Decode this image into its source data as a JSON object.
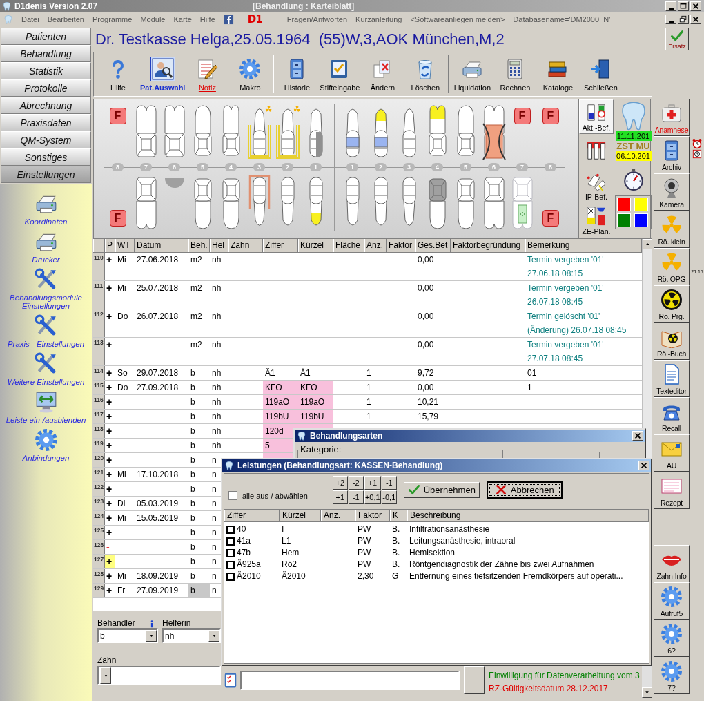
{
  "window": {
    "title": "D1denis Version 2.07",
    "document_title": "[Behandlung : Karteiblatt]"
  },
  "menu": {
    "items": [
      "Datei",
      "Bearbeiten",
      "Programme",
      "Module",
      "Karte",
      "Hilfe"
    ],
    "logo": "D1",
    "links": [
      "Fragen/Antworten",
      "Kurzanleitung",
      "<Softwareanliegen melden>",
      "Databasename='DM2000_N'"
    ]
  },
  "nav": [
    {
      "label": "Patienten",
      "selected": false
    },
    {
      "label": "Behandlung",
      "selected": false
    },
    {
      "label": "Statistik",
      "selected": false
    },
    {
      "label": "Protokolle",
      "selected": false
    },
    {
      "label": "Abrechnung",
      "selected": false
    },
    {
      "label": "Praxisdaten",
      "selected": false
    },
    {
      "label": "QM-System",
      "selected": false
    },
    {
      "label": "Sonstiges",
      "selected": false
    },
    {
      "label": "Einstellungen",
      "selected": true
    }
  ],
  "settings_panel": [
    "Koordinaten",
    "Drucker",
    "Behandlungsmodule Einstellungen",
    "Praxis - Einstellungen",
    "Weitere Einstellungen",
    "Leiste ein-/ausblenden",
    "Anbindungen"
  ],
  "patient": {
    "title": "Dr. Testkasse Helga,25.05.1964  (55)W,3,AOK München,M,2",
    "ersatz": "Ersatz"
  },
  "toolbar": {
    "groups": [
      [
        {
          "label": "Hilfe",
          "selected": false,
          "alert": false
        },
        {
          "label": "Pat.Auswahl",
          "selected": true,
          "alert": false
        },
        {
          "label": "Notiz",
          "selected": false,
          "alert": true
        },
        {
          "label": "Makro",
          "selected": false,
          "alert": false
        }
      ],
      [
        {
          "label": "Historie",
          "selected": false,
          "alert": false
        },
        {
          "label": "Stifteingabe",
          "selected": false,
          "alert": false
        },
        {
          "label": "Ändern",
          "selected": false,
          "alert": false
        },
        {
          "label": "Löschen",
          "selected": false,
          "alert": false
        }
      ],
      [
        {
          "label": "Liquidation",
          "selected": false,
          "alert": false
        },
        {
          "label": "Rechnen",
          "selected": false,
          "alert": false
        },
        {
          "label": "Kataloge",
          "selected": false,
          "alert": false
        },
        {
          "label": "Schließen",
          "selected": false,
          "alert": false
        }
      ]
    ]
  },
  "dental_chart": {
    "upper": [
      {
        "kind": "flag",
        "label": "F"
      },
      {
        "kind": "molar"
      },
      {
        "kind": "molar"
      },
      {
        "kind": "premolar"
      },
      {
        "kind": "premolar-double"
      },
      {
        "kind": "canine",
        "findings": [
          {
            "kind": "bridge"
          },
          {
            "kind": "xray"
          }
        ]
      },
      {
        "kind": "incisor",
        "findings": [
          {
            "kind": "bridge"
          },
          {
            "kind": "xray"
          }
        ]
      },
      {
        "kind": "incisor",
        "findings": [
          {
            "kind": "amalgam"
          }
        ]
      },
      {
        "kind": "incisor",
        "findings": [
          {
            "kind": "composite"
          }
        ]
      },
      {
        "kind": "incisor",
        "findings": [
          {
            "kind": "tip-yellow"
          },
          {
            "kind": "composite"
          }
        ]
      },
      {
        "kind": "canine"
      },
      {
        "kind": "premolar-double",
        "findings": [
          {
            "kind": "tip-yellow"
          }
        ]
      },
      {
        "kind": "premolar"
      },
      {
        "kind": "molar",
        "findings": [
          {
            "kind": "extracted"
          }
        ]
      },
      {
        "kind": "flag",
        "label": "F"
      },
      {
        "kind": "flag",
        "label": "F"
      }
    ],
    "numbers": [
      "8",
      "7",
      "6",
      "5",
      "4",
      "3",
      "2",
      "1",
      "1",
      "2",
      "3",
      "4",
      "5",
      "6",
      "7",
      "8"
    ],
    "lower": [
      {
        "kind": "flag",
        "label": "F"
      },
      {
        "kind": "molar"
      },
      {
        "kind": "molar",
        "findings": [
          {
            "kind": "pontic"
          }
        ]
      },
      {
        "kind": "premolar"
      },
      {
        "kind": "premolar"
      },
      {
        "kind": "canine",
        "findings": [
          {
            "kind": "crown-frame"
          }
        ]
      },
      {
        "kind": "incisor"
      },
      {
        "kind": "incisor",
        "findings": [
          {
            "kind": "tip-yellow"
          }
        ]
      },
      {
        "kind": "incisor"
      },
      {
        "kind": "incisor"
      },
      {
        "kind": "canine"
      },
      {
        "kind": "premolar",
        "findings": [
          {
            "kind": "crown-grey"
          }
        ]
      },
      {
        "kind": "premolar"
      },
      {
        "kind": "molar"
      },
      {
        "kind": "molar",
        "findings": [
          {
            "kind": "implant"
          }
        ]
      },
      {
        "kind": "flag",
        "label": "F"
      }
    ]
  },
  "chart_side": {
    "buttons": [
      {
        "label": "Akt.-Bef.",
        "selected": true
      },
      {
        "selected": false
      },
      {
        "label": "IP-Bef.",
        "selected": false
      },
      {
        "label": "ZE-Plan.",
        "selected": false
      }
    ],
    "recall_date": "11.11.201",
    "status": "ZST MU",
    "next_date": "06.10.201",
    "swatches": [
      {
        "color": "#ff0000"
      },
      {
        "color": "#ffff00"
      },
      {
        "color": "#008000"
      },
      {
        "color": "#0000ff"
      }
    ]
  },
  "table": {
    "columns": [
      "P",
      "WT",
      "Datum",
      "Beh.",
      "Hel",
      "Zahn",
      "Ziffer",
      "Kürzel",
      "Fläche",
      "Anz.",
      "Faktor",
      "Ges.Bet",
      "Faktorbegründung",
      "Bemerkung"
    ],
    "rows": [
      {
        "number": "110",
        "sign": "+",
        "weekday": "Mi",
        "date": "27.06.2018",
        "behandler": "m2",
        "helferin": "nh",
        "betrag": "0,00",
        "bemerkung": "Termin vergeben '01'\n27.06.18 08:15",
        "appointment": true,
        "highlighted": false,
        "marked": false,
        "removed": false,
        "selected": false
      },
      {
        "number": "111",
        "sign": "+",
        "weekday": "Mi",
        "date": "25.07.2018",
        "behandler": "m2",
        "helferin": "nh",
        "betrag": "0,00",
        "bemerkung": "Termin vergeben '01'\n26.07.18 08:45",
        "appointment": true,
        "highlighted": false,
        "marked": false,
        "removed": false,
        "selected": false
      },
      {
        "number": "112",
        "sign": "+",
        "weekday": "Do",
        "date": "26.07.2018",
        "behandler": "m2",
        "helferin": "nh",
        "betrag": "0,00",
        "bemerkung": "Termin gelöscht '01'\n(Änderung) 26.07.18 08:45",
        "appointment": true,
        "highlighted": false,
        "marked": false,
        "removed": false,
        "selected": false
      },
      {
        "number": "113",
        "sign": "+",
        "behandler": "m2",
        "helferin": "nh",
        "betrag": "0,00",
        "bemerkung": "Termin vergeben '01'\n27.07.18 08:45",
        "appointment": true,
        "highlighted": false,
        "marked": false,
        "removed": false,
        "selected": false
      },
      {
        "number": "114",
        "sign": "+",
        "weekday": "So",
        "date": "29.07.2018",
        "behandler": "b",
        "helferin": "nh",
        "ziffer": "Ä1",
        "kuerzel": "Ä1",
        "anzahl": "1",
        "betrag": "9,72",
        "bemerkung": "01",
        "appointment": false,
        "highlighted": false,
        "marked": false,
        "removed": false,
        "selected": false
      },
      {
        "number": "115",
        "sign": "+",
        "weekday": "Do",
        "date": "27.09.2018",
        "behandler": "b",
        "helferin": "nh",
        "ziffer": "KFO",
        "kuerzel": "KFO",
        "anzahl": "1",
        "betrag": "0,00",
        "bemerkung": "1",
        "appointment": false,
        "highlighted": true,
        "marked": false,
        "removed": false,
        "selected": false
      },
      {
        "number": "116",
        "sign": "+",
        "behandler": "b",
        "helferin": "nh",
        "ziffer": "119aO",
        "kuerzel": "119aO",
        "anzahl": "1",
        "betrag": "10,21",
        "highlighted": true,
        "marked": false,
        "removed": false,
        "selected": false
      },
      {
        "number": "117",
        "sign": "+",
        "behandler": "b",
        "helferin": "nh",
        "ziffer": "119bU",
        "kuerzel": "119bU",
        "anzahl": "1",
        "betrag": "15,79",
        "highlighted": true,
        "marked": false,
        "removed": false,
        "selected": false
      },
      {
        "number": "118",
        "sign": "+",
        "behandler": "b",
        "helferin": "nh",
        "ziffer": "120d",
        "highlighted": true,
        "marked": false,
        "removed": false,
        "selected": false
      },
      {
        "number": "119",
        "sign": "+",
        "behandler": "b",
        "helferin": "nh",
        "ziffer": "5",
        "highlighted": true,
        "marked": false,
        "removed": false,
        "selected": false
      },
      {
        "number": "120",
        "sign": "+",
        "behandler": "b",
        "helferin": "n",
        "highlighted": true,
        "marked": false,
        "removed": false,
        "selected": false
      },
      {
        "number": "121",
        "sign": "+",
        "weekday": "Mi",
        "date": "17.10.2018",
        "behandler": "b",
        "helferin": "n",
        "highlighted": false,
        "marked": false,
        "removed": false,
        "selected": false
      },
      {
        "number": "122",
        "sign": "+",
        "behandler": "b",
        "helferin": "n",
        "highlighted": false,
        "marked": false,
        "removed": false,
        "selected": false
      },
      {
        "number": "123",
        "sign": "+",
        "weekday": "Di",
        "date": "05.03.2019",
        "behandler": "b",
        "helferin": "n",
        "highlighted": false,
        "marked": false,
        "removed": false,
        "selected": false
      },
      {
        "number": "124",
        "sign": "+",
        "weekday": "Mi",
        "date": "15.05.2019",
        "behandler": "b",
        "helferin": "n",
        "highlighted": false,
        "marked": false,
        "removed": false,
        "selected": false
      },
      {
        "number": "125",
        "sign": "+",
        "behandler": "b",
        "helferin": "n",
        "highlighted": false,
        "marked": false,
        "removed": false,
        "selected": false
      },
      {
        "number": "126",
        "sign": "-",
        "behandler": "b",
        "helferin": "n",
        "highlighted": false,
        "marked": false,
        "removed": true,
        "selected": false
      },
      {
        "number": "127",
        "sign": "+",
        "behandler": "b",
        "helferin": "n",
        "highlighted": false,
        "marked": true,
        "removed": false,
        "selected": false
      },
      {
        "number": "128",
        "sign": "+",
        "weekday": "Mi",
        "date": "18.09.2019",
        "behandler": "b",
        "helferin": "n",
        "highlighted": false,
        "marked": false,
        "removed": false,
        "selected": false
      },
      {
        "number": "129",
        "sign": "+",
        "weekday": "Fr",
        "date": "27.09.2019",
        "behandler": "b",
        "helferin": "n",
        "highlighted": false,
        "marked": false,
        "removed": false,
        "selected": true
      }
    ]
  },
  "entry_form": {
    "fields": [
      {
        "label": "Behandler",
        "value": "b",
        "info": true
      },
      {
        "label": "Helferin",
        "value": "nh",
        "info": false
      },
      {
        "label": "Zahn",
        "info": false
      }
    ]
  },
  "notes": [
    {
      "text": "Einwilligung für Datenverarbeitung vom 3",
      "color": "#008000"
    },
    {
      "text": "RZ-Gültigkeitsdatum 28.12.2017",
      "color": "#e00000"
    }
  ],
  "side_buttons": [
    {
      "kind": "button",
      "label": "Anamnese",
      "alert": true
    },
    {
      "kind": "button",
      "label": "Archiv",
      "alert": false
    },
    {
      "kind": "button",
      "label": "Kamera",
      "alert": false
    },
    {
      "kind": "button",
      "label": "Rö. klein",
      "alert": false
    },
    {
      "kind": "button",
      "label": "Rö. OPG",
      "alert": false
    },
    {
      "kind": "button",
      "label": "Rö. Prg.",
      "alert": false
    },
    {
      "kind": "button",
      "label": "Rö.-Buch",
      "alert": false
    },
    {
      "kind": "button",
      "label": "Texteditor",
      "alert": false
    },
    {
      "kind": "button",
      "label": "Recall",
      "alert": false
    },
    {
      "kind": "button",
      "label": "AU",
      "alert": false
    },
    {
      "kind": "button",
      "label": "Rezept",
      "alert": false
    },
    {
      "kind": "gap"
    },
    {
      "kind": "button",
      "label": "Zahn-Info",
      "alert": false
    },
    {
      "kind": "button",
      "label": "Aufruf5",
      "alert": false
    },
    {
      "kind": "button",
      "label": "6?",
      "alert": false
    },
    {
      "kind": "button",
      "label": "7?",
      "alert": false
    }
  ],
  "clock": {
    "time": "21:15"
  },
  "treatment_types_dialog": {
    "title": "Behandlungsarten",
    "group": "Kategorie:"
  },
  "services_dialog": {
    "title": "Leistungen (Behandlungsart: KASSEN-Behandlung)",
    "select_all": {
      "label": "alle aus-/ abwählen",
      "checked": false
    },
    "steps": [
      "+2",
      "-2",
      "+1",
      "-1",
      "+1",
      "-1",
      "+0,1",
      "-0,1"
    ],
    "buttons": [
      {
        "label": "Übernehmen",
        "focused": false
      },
      {
        "label": "Abbrechen",
        "focused": true
      }
    ],
    "columns": [
      "Ziffer",
      "Kürzel",
      "Anz.",
      "Faktor",
      "K",
      "Beschreibung"
    ],
    "rows": [
      {
        "ziffer": "40",
        "kuerzel": "I",
        "faktor": "PW",
        "k": "B.",
        "beschreibung": "Infiltrationsanästhesie",
        "checked": false
      },
      {
        "ziffer": "41a",
        "kuerzel": "L1",
        "faktor": "PW",
        "k": "B.",
        "beschreibung": "Leitungsanästhesie,  intraoral",
        "checked": false
      },
      {
        "ziffer": "47b",
        "kuerzel": "Hem",
        "faktor": "PW",
        "k": "B.",
        "beschreibung": "Hemisektion",
        "checked": false
      },
      {
        "ziffer": "Ä925a",
        "kuerzel": "Rö2",
        "faktor": "PW",
        "k": "B.",
        "beschreibung": "Röntgendiagnostik der Zähne bis zwei Aufnahmen",
        "checked": false
      },
      {
        "ziffer": "Ä2010",
        "kuerzel": "Ä2010",
        "faktor": "2,30",
        "k": "G",
        "beschreibung": "Entfernung eines tiefsitzenden Fremdkörpers auf operati...",
        "checked": false
      }
    ]
  }
}
